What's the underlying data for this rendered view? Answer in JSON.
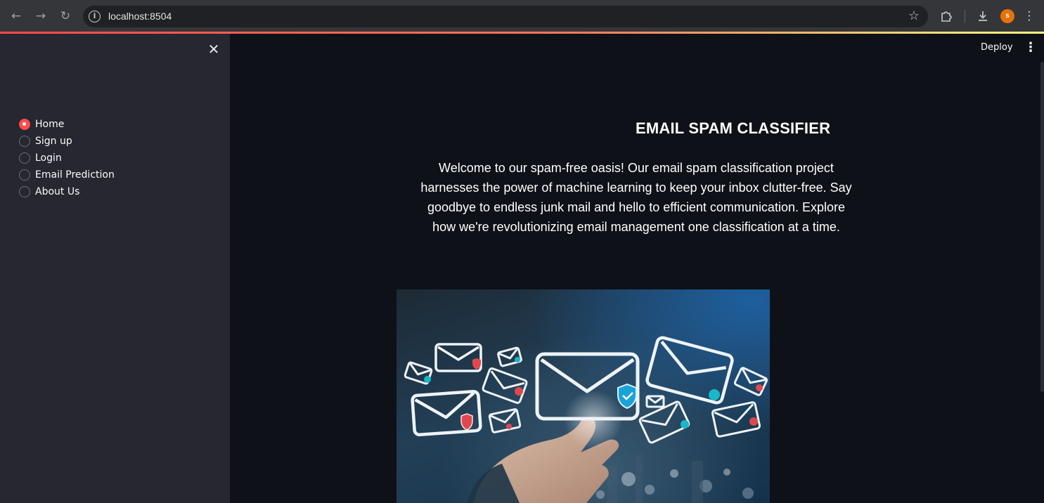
{
  "browser": {
    "url": "localhost:8504",
    "profile_initial": "s",
    "icons": {
      "back": "back-arrow-icon",
      "forward": "forward-arrow-icon",
      "reload": "reload-icon",
      "site_info": "info-icon",
      "bookmark": "star-icon",
      "extensions": "puzzle-icon",
      "downloads": "download-icon",
      "menu": "kebab-menu-icon"
    },
    "colors": {
      "toolbar": "#35363a",
      "avatar": "#e8710a",
      "accent": "#ff4b4b"
    }
  },
  "sidebar": {
    "close_icon": "close-icon",
    "nav": [
      {
        "label": "Home",
        "selected": true
      },
      {
        "label": "Sign up",
        "selected": false
      },
      {
        "label": "Login",
        "selected": false
      },
      {
        "label": "Email Prediction",
        "selected": false
      },
      {
        "label": "About Us",
        "selected": false
      }
    ]
  },
  "header": {
    "deploy_label": "Deploy",
    "menu_icon": "kebab-menu-icon"
  },
  "main": {
    "title": "EMAIL SPAM CLASSIFIER",
    "intro": "Welcome to our spam-free oasis! Our email spam classification project harnesses the power of machine learning to keep your inbox clutter-free. Say goodbye to endless junk mail and hello to efficient communication. Explore how we're revolutionizing email management one classification at a time.",
    "hero_image": "hand-touching-email-envelopes-image"
  }
}
